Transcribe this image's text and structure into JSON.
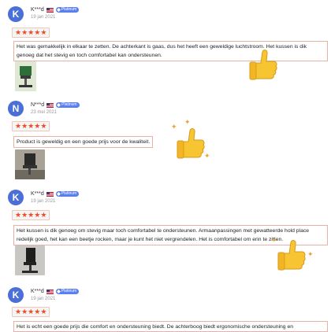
{
  "reviews": [
    {
      "initial": "K",
      "avatar_color": "#4a6fd6",
      "name": "K***d",
      "badge": "Platinum",
      "date": "19 jan 2021",
      "rating": 5,
      "text": "Het was gemakkelijk in elkaar te zetten. De achterkant is gaas, dus het heeft een geweldige luchtstroom. Het kussen is dik genoeg dat het stevig en toch comfortabel kan ondersteunen."
    },
    {
      "initial": "N",
      "avatar_color": "#4a6fd6",
      "name": "N***d",
      "badge": "Platinum",
      "date": "23 mei 2021",
      "rating": 5,
      "text": "Product is geweldig en een goede prijs voor de kwaliteit."
    },
    {
      "initial": "K",
      "avatar_color": "#4a6fd6",
      "name": "K***d",
      "badge": "Platinum",
      "date": "19 jan 2021",
      "rating": 5,
      "text": "Het kussen is dik genoeg om stevig maar toch comfortabel te ondersteunen. Armaanpassingen met gewatteerde hold place redelijk goed, het kan een beetje rocken, maar je kunt het niet vergrendelen. Het is comfortabel om erin te zitten."
    },
    {
      "initial": "K",
      "avatar_color": "#4a6fd6",
      "name": "K***d",
      "badge": "Platinum",
      "date": "19 jan 2021",
      "rating": 5,
      "text": "Het is echt een goede prijs die comfort en ondersteuning biedt. De achterboog biedt ergonomische ondersteuning en"
    }
  ],
  "icons": {
    "star": "star-icon",
    "thumb": "thumbs-up-icon",
    "flag": "us-flag-icon",
    "badge": "diamond-icon",
    "sparkle": "sparkle-icon"
  },
  "colors": {
    "star": "#ef4b24",
    "avatar": "#4a6fd6",
    "badge": "#5a7ff0",
    "thumb": "#f7c531"
  }
}
